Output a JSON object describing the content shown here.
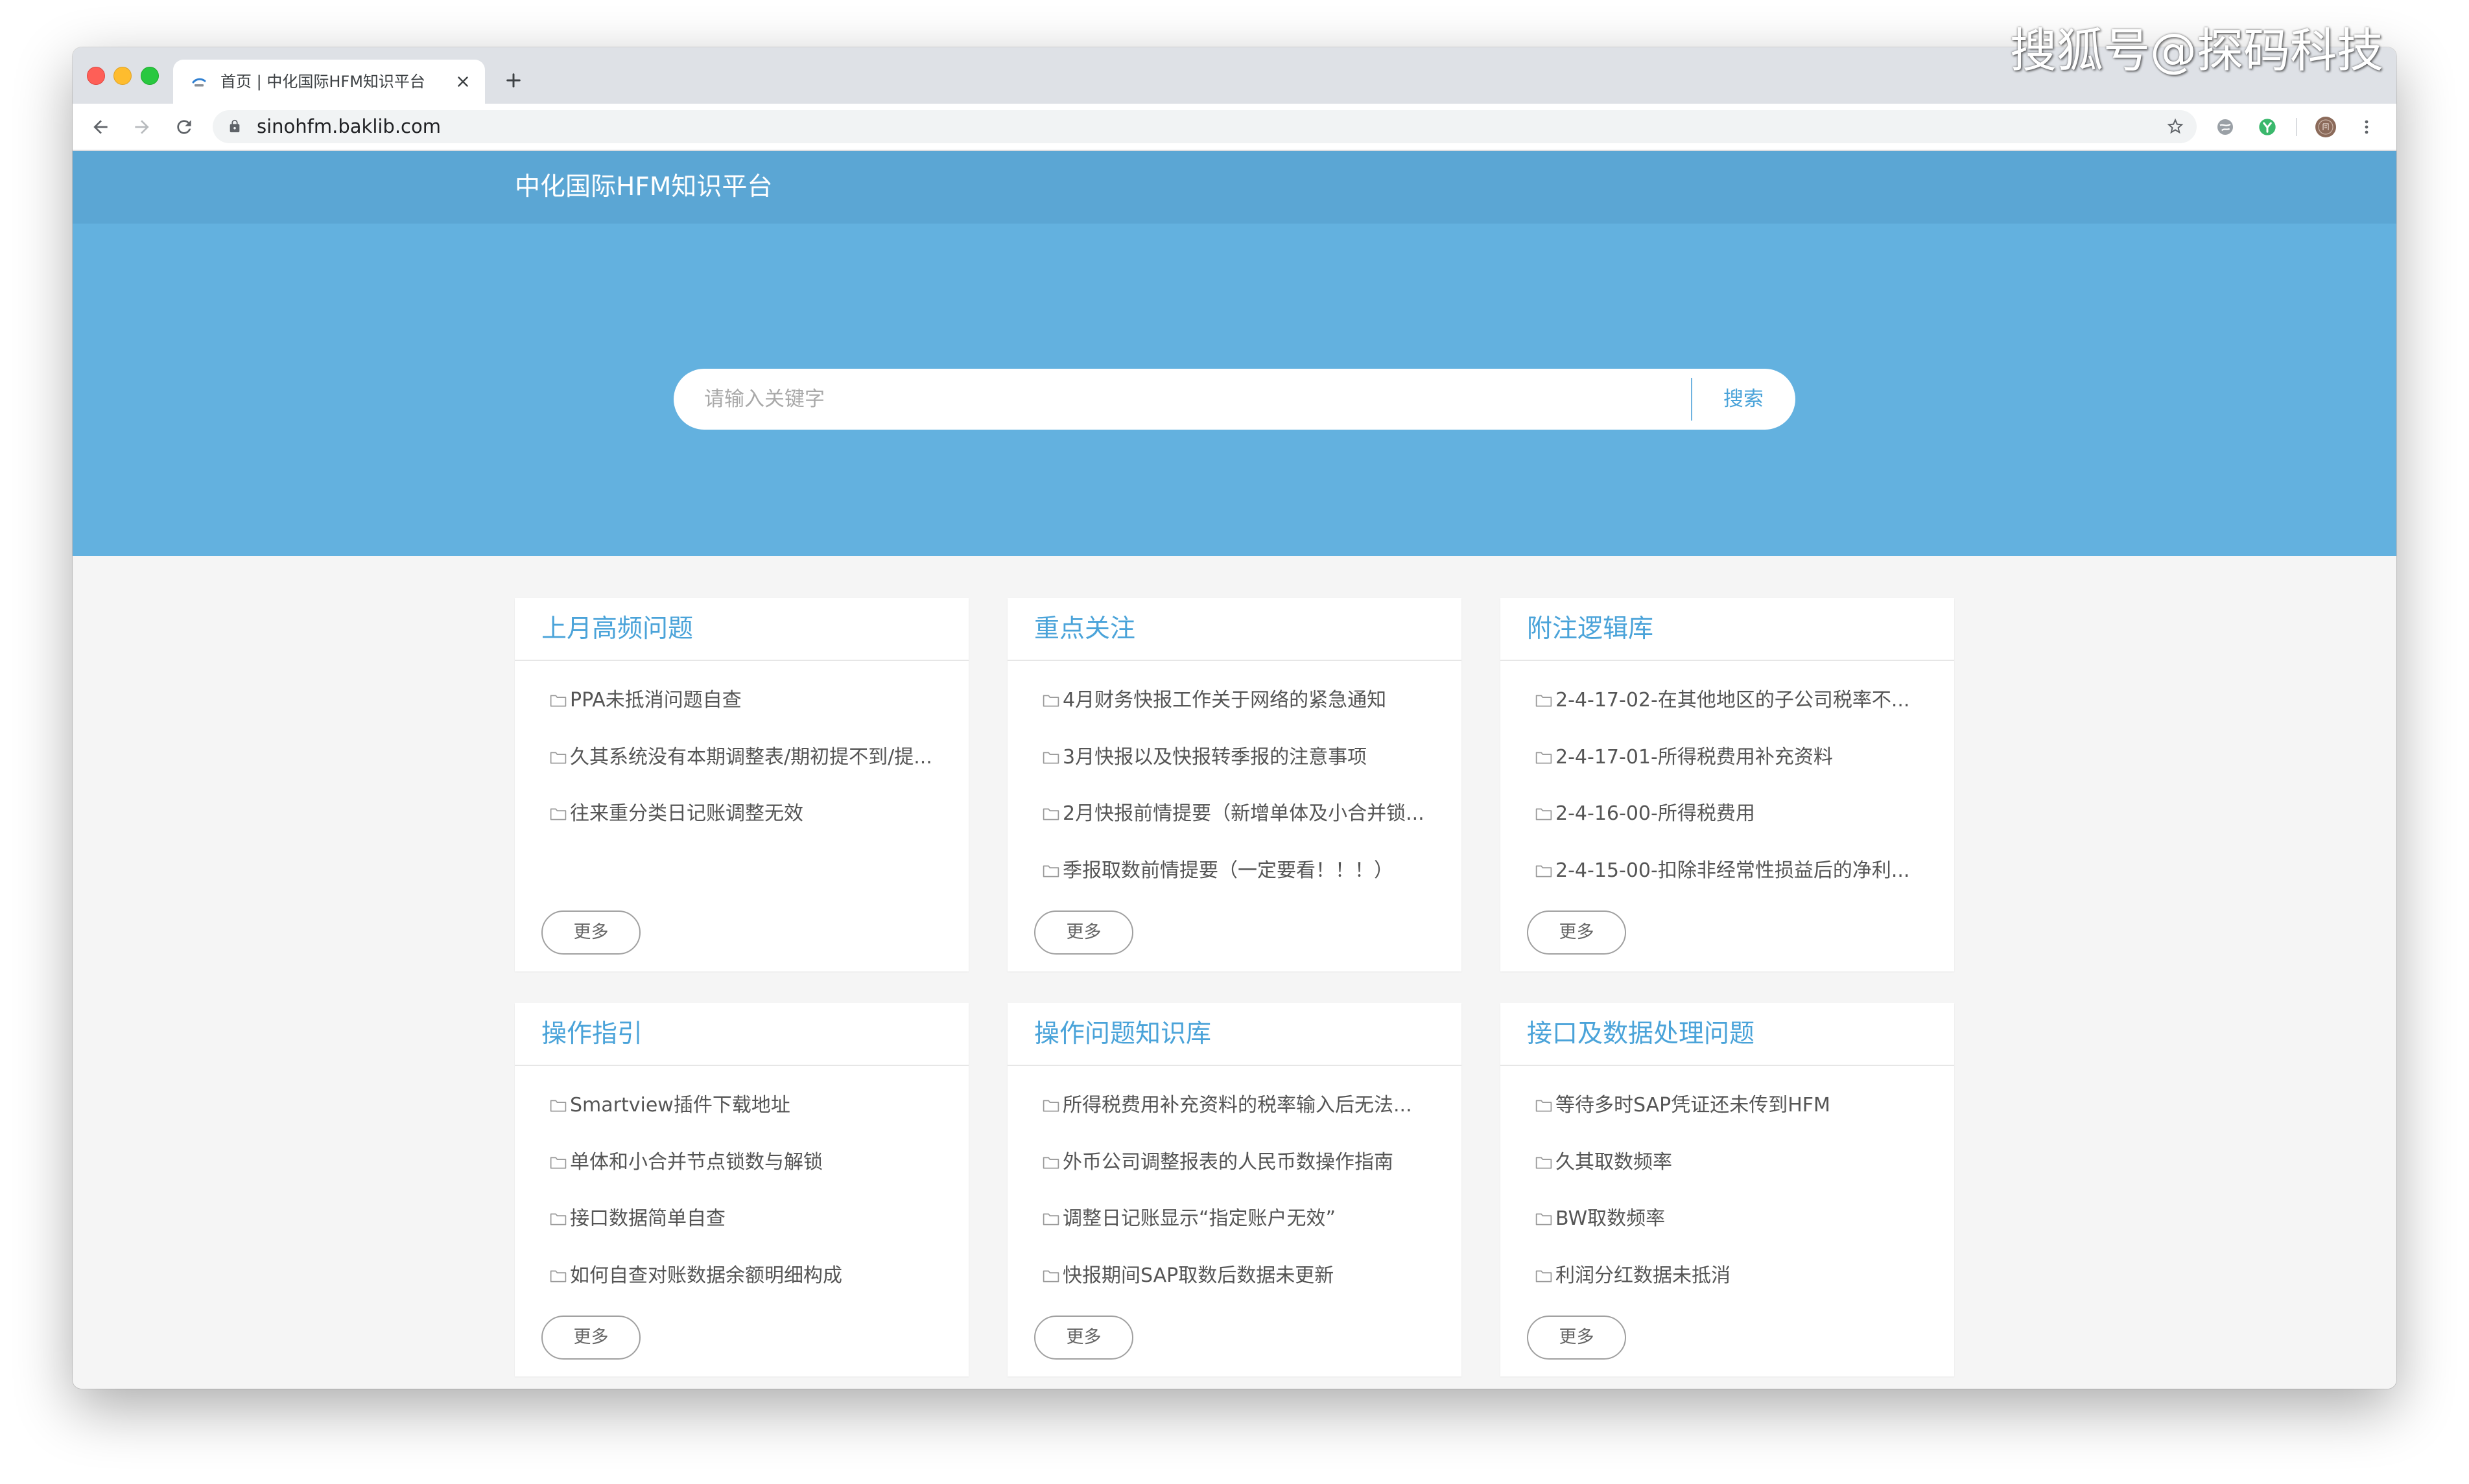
{
  "watermark": "搜狐号@探码科技",
  "browser": {
    "tab": {
      "title": "首页 | 中化国际HFM知识平台"
    },
    "address": {
      "url": "sinohfm.baklib.com"
    }
  },
  "site": {
    "header": {
      "title": "中化国际HFM知识平台"
    },
    "search": {
      "placeholder": "请输入关键字",
      "button_label": "搜索"
    }
  },
  "cards": [
    {
      "title": "上月高频问题",
      "items": [
        "PPA未抵消问题自查",
        "久其系统没有本期调整表/期初提不到/提...",
        "往来重分类日记账调整无效"
      ],
      "more_label": "更多"
    },
    {
      "title": "重点关注",
      "items": [
        "4月财务快报工作关于网络的紧急通知",
        "3月快报以及快报转季报的注意事项",
        "2月快报前情提要（新增单体及小合并锁...",
        "季报取数前情提要（一定要看！！！）"
      ],
      "more_label": "更多"
    },
    {
      "title": "附注逻辑库",
      "items": [
        "2-4-17-02-在其他地区的子公司税率不...",
        "2-4-17-01-所得税费用补充资料",
        "2-4-16-00-所得税费用",
        "2-4-15-00-扣除非经常性损益后的净利..."
      ],
      "more_label": "更多"
    },
    {
      "title": "操作指引",
      "items": [
        "Smartview插件下载地址",
        "单体和小合并节点锁数与解锁",
        "接口数据简单自查",
        "如何自查对账数据余额明细构成"
      ],
      "more_label": "更多"
    },
    {
      "title": "操作问题知识库",
      "items": [
        "所得税费用补充资料的税率输入后无法...",
        "外币公司调整报表的人民币数操作指南",
        "调整日记账显示“指定账户无效”",
        "快报期间SAP取数后数据未更新"
      ],
      "more_label": "更多"
    },
    {
      "title": "接口及数据处理问题",
      "items": [
        "等待多时SAP凭证还未传到HFM",
        "久其取数频率",
        "BW取数频率",
        "利润分红数据未抵消"
      ],
      "more_label": "更多"
    }
  ],
  "icons": {
    "tab_favicon": "site-logo-icon",
    "tab_close": "close-icon",
    "new_tab": "plus-icon",
    "back": "arrow-left-icon",
    "forward": "arrow-right-icon",
    "reload": "reload-icon",
    "secure": "lock-icon",
    "bookmark": "star-icon",
    "extension_1": "extension-globe-icon",
    "extension_2": "extension-check-icon",
    "menu": "more-vertical-icon",
    "list_item": "folder-icon"
  },
  "colors": {
    "header_bar": "#5ba6d4",
    "hero": "#63b1df",
    "accent": "#4aa3d9",
    "content_bg": "#f5f5f5"
  }
}
